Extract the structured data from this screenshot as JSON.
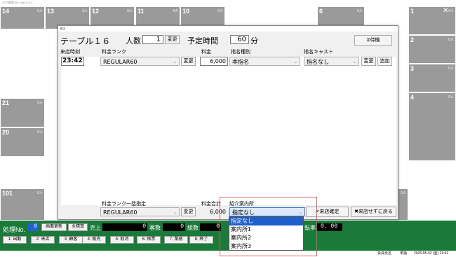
{
  "app": {
    "title": "ｽﾅｯｸ管理ｼｽﾃﾑ Ver4.0.0.0"
  },
  "tiles": [
    {
      "num": "14",
      "count": "0人",
      "sub": ""
    },
    {
      "num": "13",
      "count": "5人",
      "sub": ""
    },
    {
      "num": "12",
      "count": "0人",
      "sub": ""
    },
    {
      "num": "11",
      "count": "4人",
      "sub": ""
    },
    {
      "num": "10",
      "count": "0人",
      "sub": ""
    },
    {
      "num": "6",
      "count": "0人",
      "sub": ""
    },
    {
      "num": "1",
      "count": "0人",
      "sub": ""
    },
    {
      "num": "2",
      "count": "0人",
      "sub": ""
    },
    {
      "num": "3",
      "count": "0人",
      "sub": ""
    },
    {
      "num": "4",
      "count": "0人",
      "sub": ""
    },
    {
      "num": "21",
      "count": "0人",
      "sub": ""
    },
    {
      "num": "20",
      "count": "0人",
      "sub": ""
    },
    {
      "num": "101",
      "count": "0人",
      "sub": ""
    },
    {
      "num": "",
      "count": "0人",
      "sub": ""
    }
  ],
  "dialog": {
    "titlebar": "来店",
    "table_label": "テーブル１６",
    "people_label": "人数",
    "people_value": "1",
    "people_change": "変更",
    "planned_time_label": "予定時間",
    "planned_time_value": "60",
    "minutes_label": "分",
    "wait_button": "⧖待機",
    "col_arrival": "来店時刻",
    "col_rank": "料金ランク",
    "col_fee": "料金",
    "col_nomination": "指名種別",
    "col_cast": "指名キャスト",
    "arrival_time": "23:42",
    "rank_value": "REGULAR60",
    "rank_change": "変更",
    "fee_value": "6,000",
    "nomination_value": "本指名",
    "cast_value": "指名なし",
    "cast_change": "変更",
    "cast_add": "追加",
    "bulk_rank_label": "料金ランク一括指定",
    "bulk_rank_value": "REGULAR60",
    "bulk_change": "変更",
    "total_label": "料金合計",
    "total_value": "6,000",
    "referral_label": "紹介案内所",
    "referral_value": "指定なし",
    "confirm_button": "✔来店確定",
    "cancel_button": "✖来店せずに戻る",
    "referral_options": [
      "指定なし",
      "案内所1",
      "案内所2",
      "案内所3"
    ]
  },
  "statusbar": {
    "process_label": "処理No.",
    "process_value": "0",
    "refresh": "画面更新",
    "total_settle": "全精算",
    "sales_label": "売上",
    "sales_value": "0",
    "guests_label": "客数",
    "guests_value": "0",
    "groups_label": "組数",
    "groups_value": "0",
    "extra_value": "0",
    "rate_label": "転率",
    "rate_value": "0. 00",
    "fkeys": [
      "1: 出勤",
      "2: 来店",
      "3: 顧客",
      "4: 販売",
      "5: 取消",
      "6: 帳票",
      "7: 業務",
      "8: 終了"
    ],
    "member_label": "会員氏名",
    "member_value": "単独",
    "datetime": "2025-05-02 (金) 23:42"
  },
  "colors": {
    "status_green": "#1a7a3a",
    "highlight_red": "#e05a5a",
    "selection_blue": "#1e5fcc"
  }
}
